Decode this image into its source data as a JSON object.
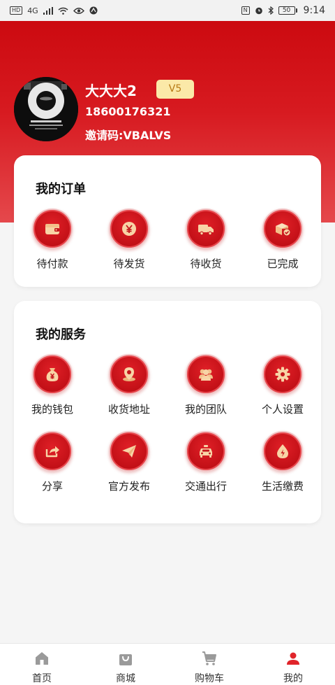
{
  "status_bar": {
    "left_badges": [
      "HD",
      "4G"
    ],
    "time": "9:14",
    "battery": "50",
    "nfc": "N"
  },
  "profile": {
    "name": "大大大2",
    "level": "V5",
    "phone": "18600176321",
    "invite": "邀请码:VBALVS"
  },
  "orders": {
    "title": "我的订单",
    "items": [
      {
        "label": "待付款",
        "icon": "wallet-icon"
      },
      {
        "label": "待发货",
        "icon": "yen-coin-icon"
      },
      {
        "label": "待收货",
        "icon": "truck-icon"
      },
      {
        "label": "已完成",
        "icon": "box-check-icon"
      }
    ]
  },
  "services": {
    "title": "我的服务",
    "items": [
      {
        "label": "我的钱包",
        "icon": "money-bag-icon"
      },
      {
        "label": "收货地址",
        "icon": "location-pin-icon"
      },
      {
        "label": "我的团队",
        "icon": "team-icon"
      },
      {
        "label": "个人设置",
        "icon": "gear-icon"
      },
      {
        "label": "分享",
        "icon": "share-icon"
      },
      {
        "label": "官方发布",
        "icon": "paper-plane-icon"
      },
      {
        "label": "交通出行",
        "icon": "taxi-icon"
      },
      {
        "label": "生活缴费",
        "icon": "utility-drop-icon"
      }
    ]
  },
  "bottom_nav": {
    "items": [
      {
        "label": "首页",
        "icon": "home-icon"
      },
      {
        "label": "商城",
        "icon": "shopping-bag-icon"
      },
      {
        "label": "购物车",
        "icon": "cart-icon"
      },
      {
        "label": "我的",
        "icon": "user-icon"
      }
    ],
    "active_index": 3,
    "active_color": "#e0242a",
    "inactive_color": "#9a9a9a"
  },
  "colors": {
    "brand_red": "#d7141b",
    "badge_bg": "#fbe9a8",
    "badge_text": "#b77a14"
  }
}
